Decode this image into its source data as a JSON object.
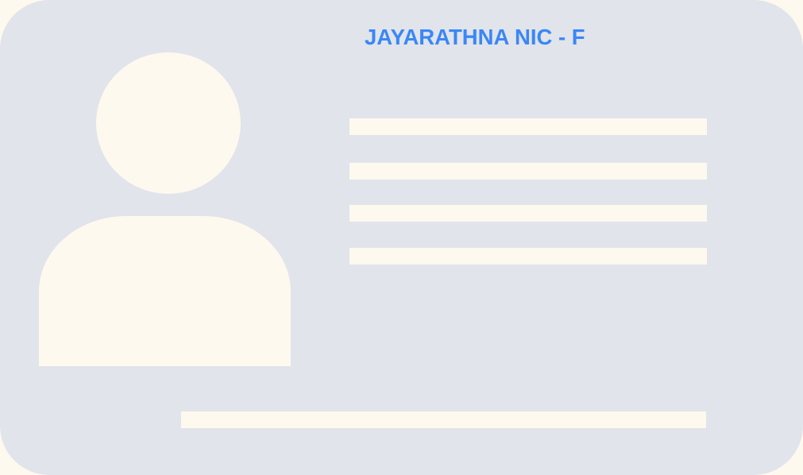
{
  "card": {
    "title": "JAYARATHNA NIC - F",
    "accent_color": "#3a87f6",
    "card_color": "#e1e4ea",
    "placeholder_color": "#fef9ef",
    "avatar_icon": "person-silhouette-icon"
  }
}
